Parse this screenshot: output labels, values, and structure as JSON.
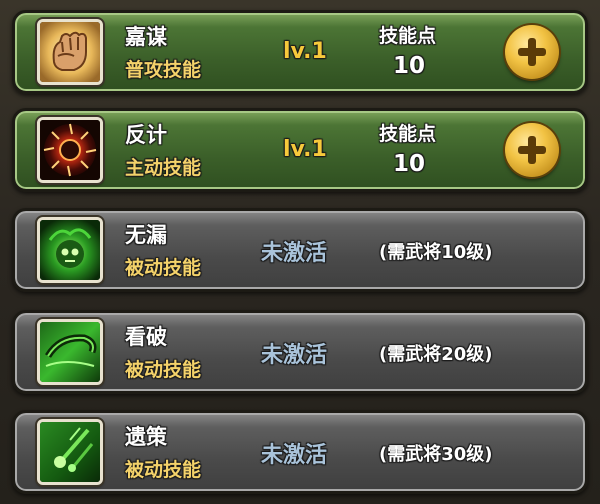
{
  "skills": [
    {
      "name": "嘉谋",
      "type": "普攻技能",
      "state": "active",
      "level": "lv.1",
      "points_label": "技能点",
      "points_value": "10",
      "icon": "fist-icon"
    },
    {
      "name": "反计",
      "type": "主动技能",
      "state": "active",
      "level": "lv.1",
      "points_label": "技能点",
      "points_value": "10",
      "icon": "burst-icon"
    },
    {
      "name": "无漏",
      "type": "被动技能",
      "state": "locked",
      "status": "未激活",
      "requirement": "(需武将10级)",
      "icon": "green-skull-icon"
    },
    {
      "name": "看破",
      "type": "被动技能",
      "state": "locked",
      "status": "未激活",
      "requirement": "(需武将20级)",
      "icon": "green-swirl-icon"
    },
    {
      "name": "遗策",
      "type": "被动技能",
      "state": "locked",
      "status": "未激活",
      "requirement": "(需武将30级)",
      "icon": "green-comet-icon"
    }
  ],
  "colors": {
    "active_card": "#3b5f29",
    "locked_card": "#4a4a4a",
    "skill_type_text": "#f4d26a",
    "level_text": "#f7c93b",
    "status_text": "#a9c3da",
    "plus_button": "#f2c344"
  }
}
